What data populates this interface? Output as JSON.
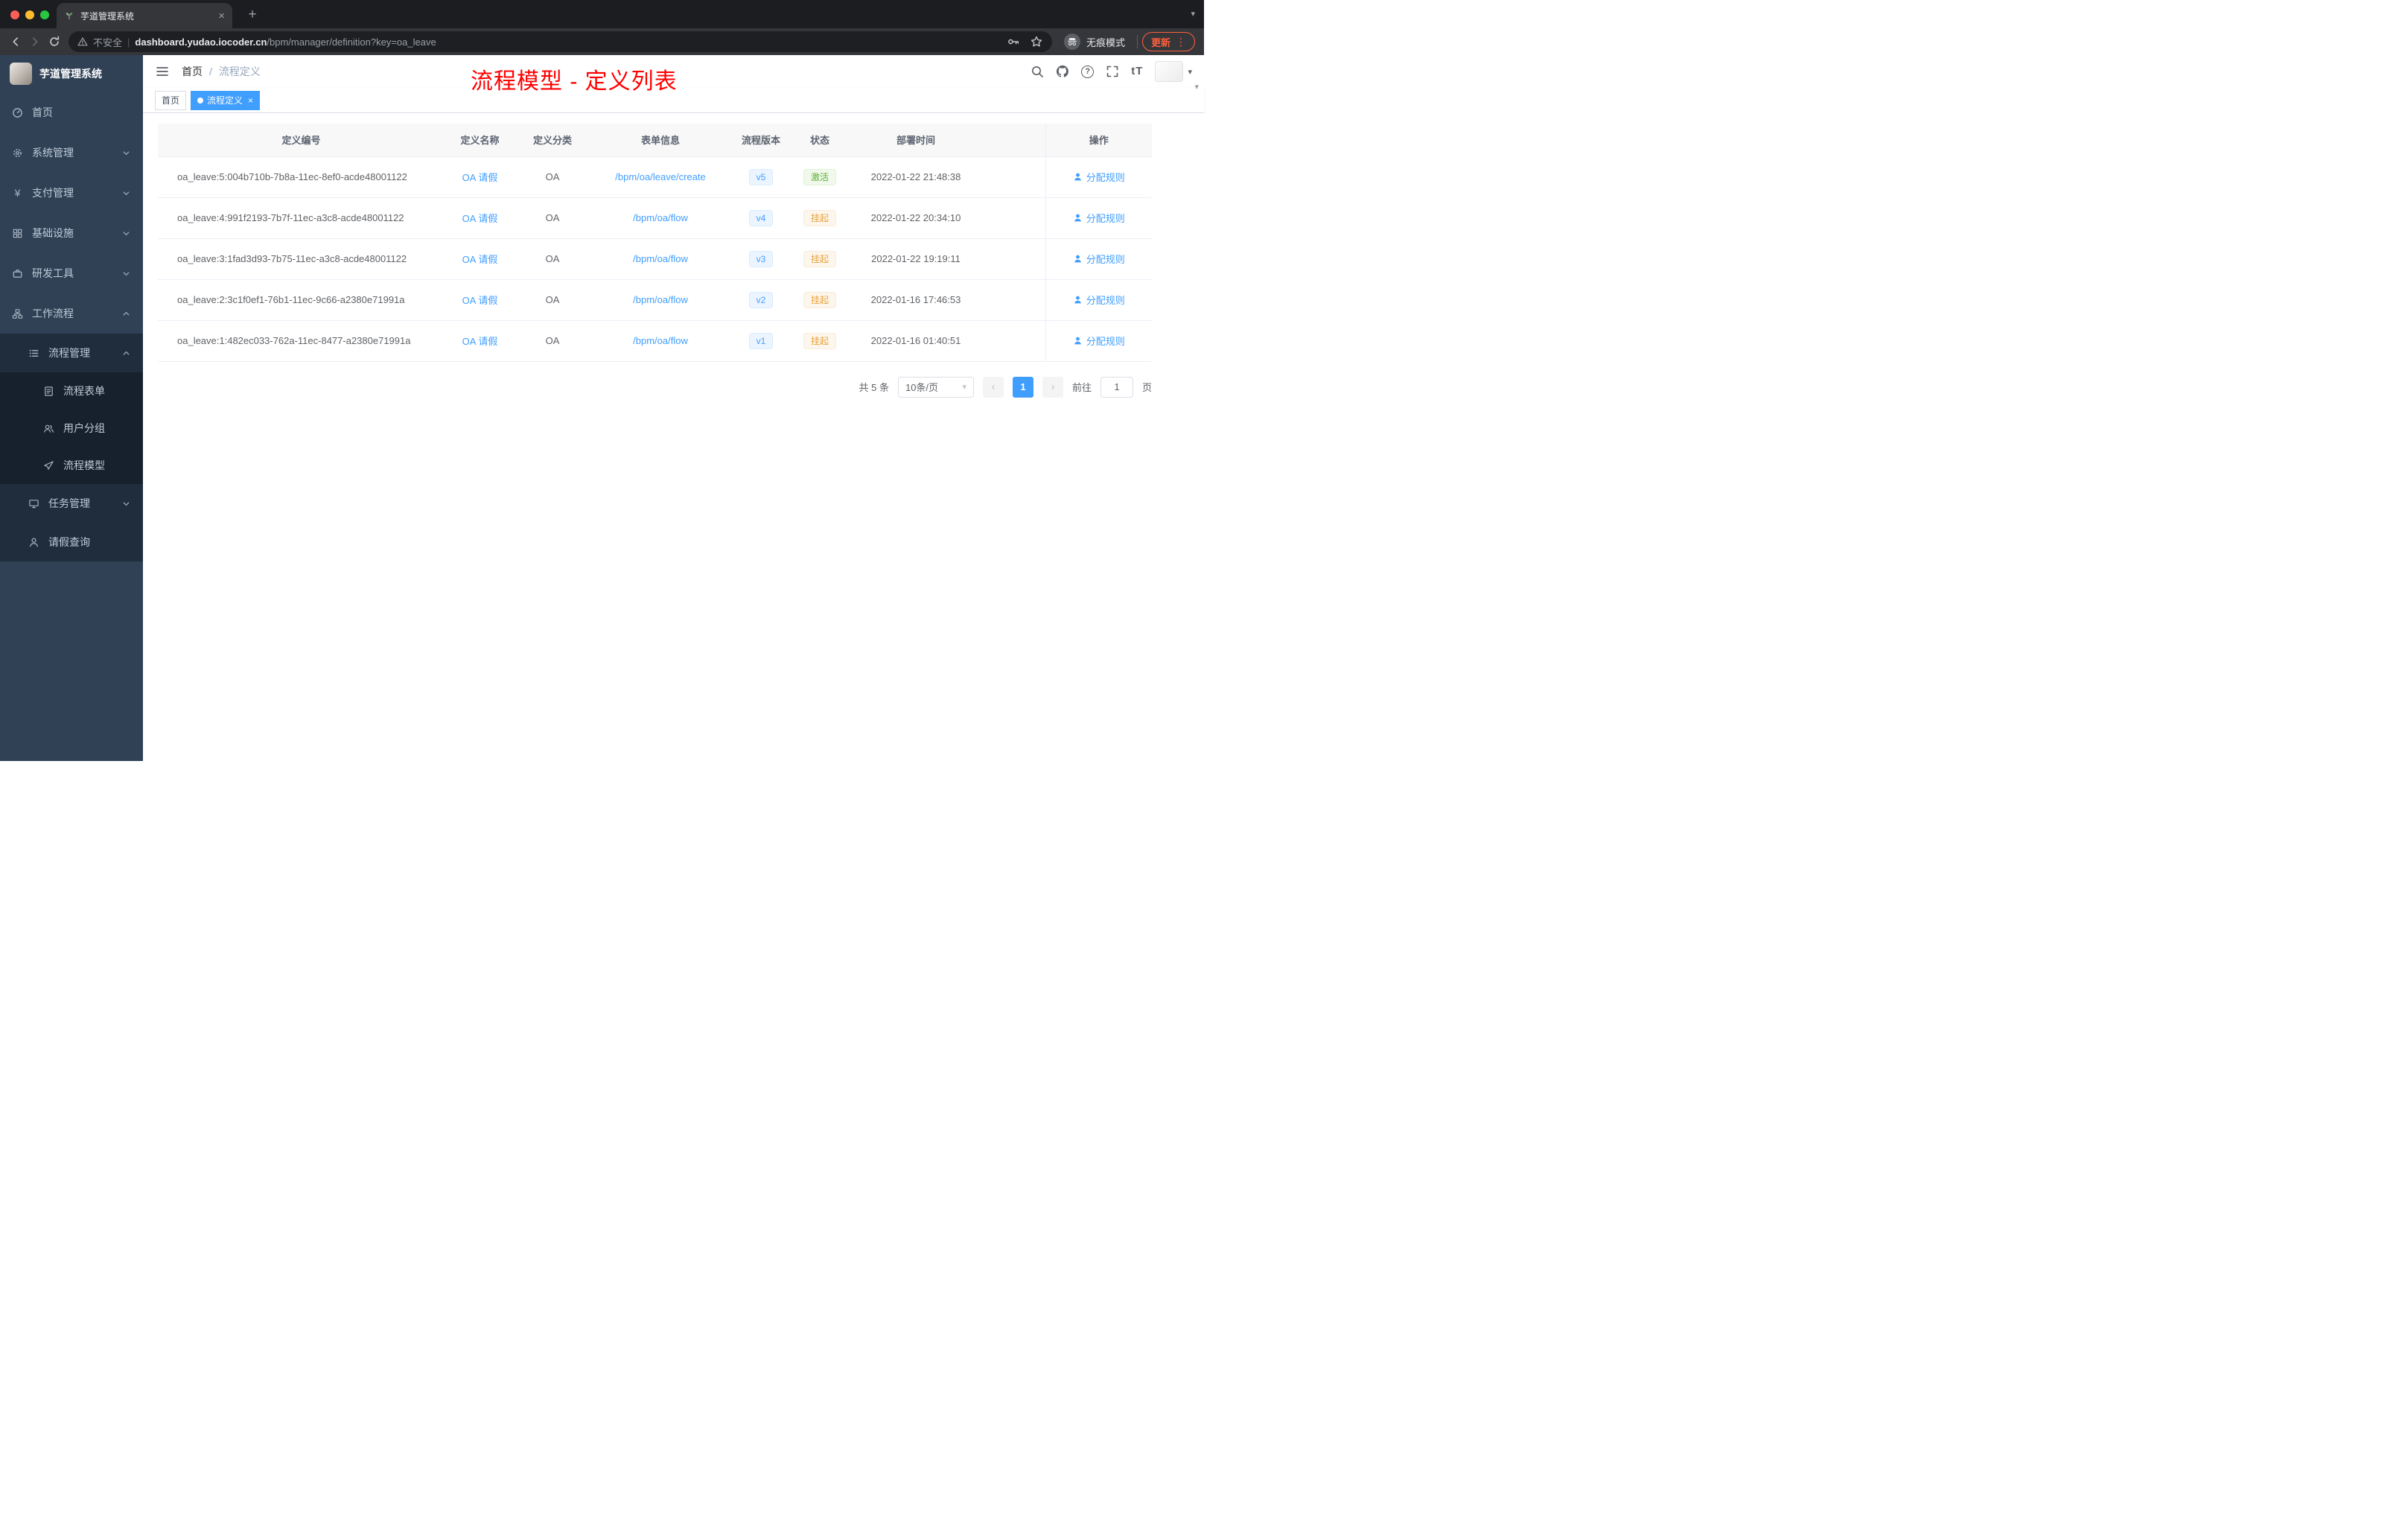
{
  "browser": {
    "tab_title": "芋道管理系统",
    "security_label": "不安全",
    "url_host": "dashboard.yudao.iocoder.cn",
    "url_path": "/bpm/manager/definition?key=oa_leave",
    "incognito_label": "无痕模式",
    "update_label": "更新"
  },
  "sidebar": {
    "logo_title": "芋道管理系统",
    "menu": [
      {
        "icon": "gauge-icon",
        "label": "首页",
        "level": 0
      },
      {
        "icon": "gear-icon",
        "label": "系统管理",
        "level": 0,
        "chevron": "down"
      },
      {
        "icon": "yen-icon",
        "label": "支付管理",
        "level": 0,
        "chevron": "down"
      },
      {
        "icon": "grid-icon",
        "label": "基础设施",
        "level": 0,
        "chevron": "down"
      },
      {
        "icon": "toolbox-icon",
        "label": "研发工具",
        "level": 0,
        "chevron": "down"
      },
      {
        "icon": "workflow-icon",
        "label": "工作流程",
        "level": 0,
        "chevron": "up"
      },
      {
        "icon": "list-icon",
        "label": "流程管理",
        "level": 1,
        "chevron": "up"
      },
      {
        "icon": "form-icon",
        "label": "流程表单",
        "level": 2
      },
      {
        "icon": "users-icon",
        "label": "用户分组",
        "level": 2
      },
      {
        "icon": "plane-icon",
        "label": "流程模型",
        "level": 2
      },
      {
        "icon": "monitor-icon",
        "label": "任务管理",
        "level": 1,
        "chevron": "down"
      },
      {
        "icon": "person-icon",
        "label": "请假查询",
        "level": 1
      }
    ]
  },
  "header": {
    "breadcrumb": [
      "首页",
      "流程定义"
    ],
    "actions": [
      "search-icon",
      "github-icon",
      "question-icon",
      "fullscreen-icon",
      "font-size-icon"
    ],
    "annotation": "流程模型 - 定义列表"
  },
  "tags": [
    {
      "label": "首页",
      "active": false,
      "closable": false
    },
    {
      "label": "流程定义",
      "active": true,
      "closable": true
    }
  ],
  "table": {
    "columns": [
      "定义编号",
      "定义名称",
      "定义分类",
      "表单信息",
      "流程版本",
      "状态",
      "部署时间",
      "",
      "操作"
    ],
    "rows": [
      {
        "id": "oa_leave:5:004b710b-7b8a-11ec-8ef0-acde48001122",
        "name": "OA 请假",
        "category": "OA",
        "form": "/bpm/oa/leave/create",
        "version": "v5",
        "status": "激活",
        "status_type": "success",
        "time": "2022-01-22 21:48:38",
        "action": "分配规则"
      },
      {
        "id": "oa_leave:4:991f2193-7b7f-11ec-a3c8-acde48001122",
        "name": "OA 请假",
        "category": "OA",
        "form": "/bpm/oa/flow",
        "version": "v4",
        "status": "挂起",
        "status_type": "warning",
        "time": "2022-01-22 20:34:10",
        "action": "分配规则"
      },
      {
        "id": "oa_leave:3:1fad3d93-7b75-11ec-a3c8-acde48001122",
        "name": "OA 请假",
        "category": "OA",
        "form": "/bpm/oa/flow",
        "version": "v3",
        "status": "挂起",
        "status_type": "warning",
        "time": "2022-01-22 19:19:11",
        "action": "分配规则"
      },
      {
        "id": "oa_leave:2:3c1f0ef1-76b1-11ec-9c66-a2380e71991a",
        "name": "OA 请假",
        "category": "OA",
        "form": "/bpm/oa/flow",
        "version": "v2",
        "status": "挂起",
        "status_type": "warning",
        "time": "2022-01-16 17:46:53",
        "action": "分配规则"
      },
      {
        "id": "oa_leave:1:482ec033-762a-11ec-8477-a2380e71991a",
        "name": "OA 请假",
        "category": "OA",
        "form": "/bpm/oa/flow",
        "version": "v1",
        "status": "挂起",
        "status_type": "warning",
        "time": "2022-01-16 01:40:51",
        "action": "分配规则"
      }
    ]
  },
  "pagination": {
    "total": "共 5 条",
    "page_size": "10条/页",
    "current_page": "1",
    "goto_label": "前往",
    "goto_value": "1",
    "unit_label": "页"
  },
  "colors": {
    "accent": "#409eff",
    "success": "#67c23a",
    "warning": "#e6a23c",
    "annotation_red": "#fe0000",
    "sidebar_bg": "#304156",
    "submenu_bg": "#1f2d3d",
    "update_orange": "#ff5f3d"
  }
}
